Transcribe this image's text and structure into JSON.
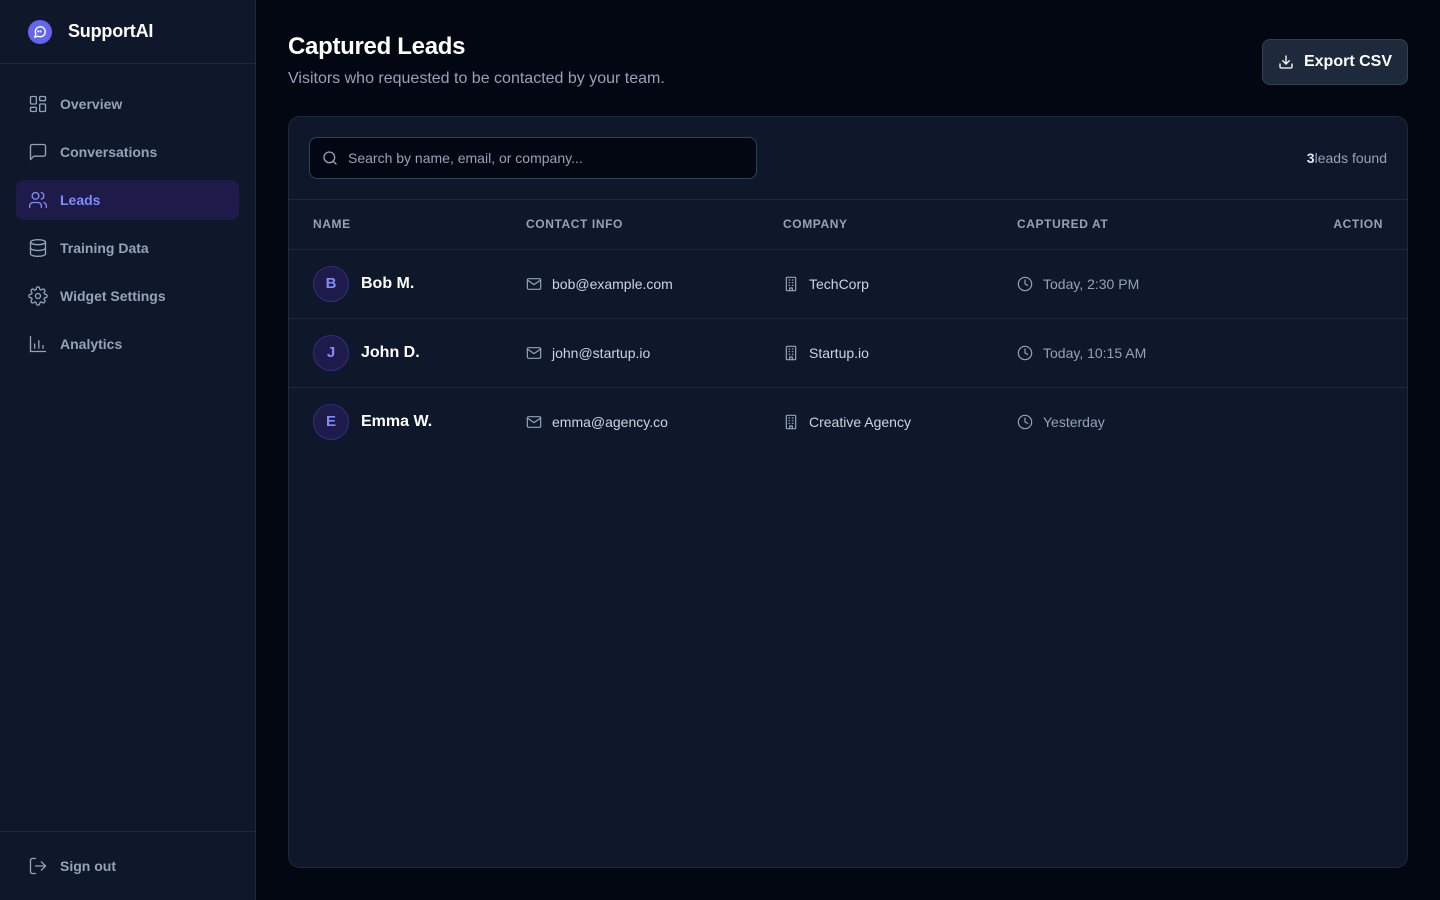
{
  "brand": {
    "name": "SupportAI",
    "accent": "#6366f1"
  },
  "sidebar": {
    "items": [
      {
        "label": "Overview",
        "icon": "grid-icon"
      },
      {
        "label": "Conversations",
        "icon": "chat-icon"
      },
      {
        "label": "Leads",
        "icon": "users-icon",
        "active": true
      },
      {
        "label": "Training Data",
        "icon": "database-icon"
      },
      {
        "label": "Widget Settings",
        "icon": "gear-icon"
      },
      {
        "label": "Analytics",
        "icon": "bar-chart-icon"
      }
    ],
    "signout_label": "Sign out"
  },
  "header": {
    "title": "Captured Leads",
    "subtitle": "Visitors who requested to be contacted by your team.",
    "export_label": "Export CSV"
  },
  "search": {
    "placeholder": "Search by name, email, or company...",
    "value": ""
  },
  "results": {
    "count": "3",
    "suffix": "leads found"
  },
  "table": {
    "columns": [
      "NAME",
      "CONTACT INFO",
      "COMPANY",
      "CAPTURED AT",
      "ACTION"
    ],
    "rows": [
      {
        "initial": "B",
        "name": "Bob M.",
        "email": "bob@example.com",
        "company": "TechCorp",
        "captured": "Today, 2:30 PM"
      },
      {
        "initial": "J",
        "name": "John D.",
        "email": "john@startup.io",
        "company": "Startup.io",
        "captured": "Today, 10:15 AM"
      },
      {
        "initial": "E",
        "name": "Emma W.",
        "email": "emma@agency.co",
        "company": "Creative Agency",
        "captured": "Yesterday"
      }
    ]
  }
}
